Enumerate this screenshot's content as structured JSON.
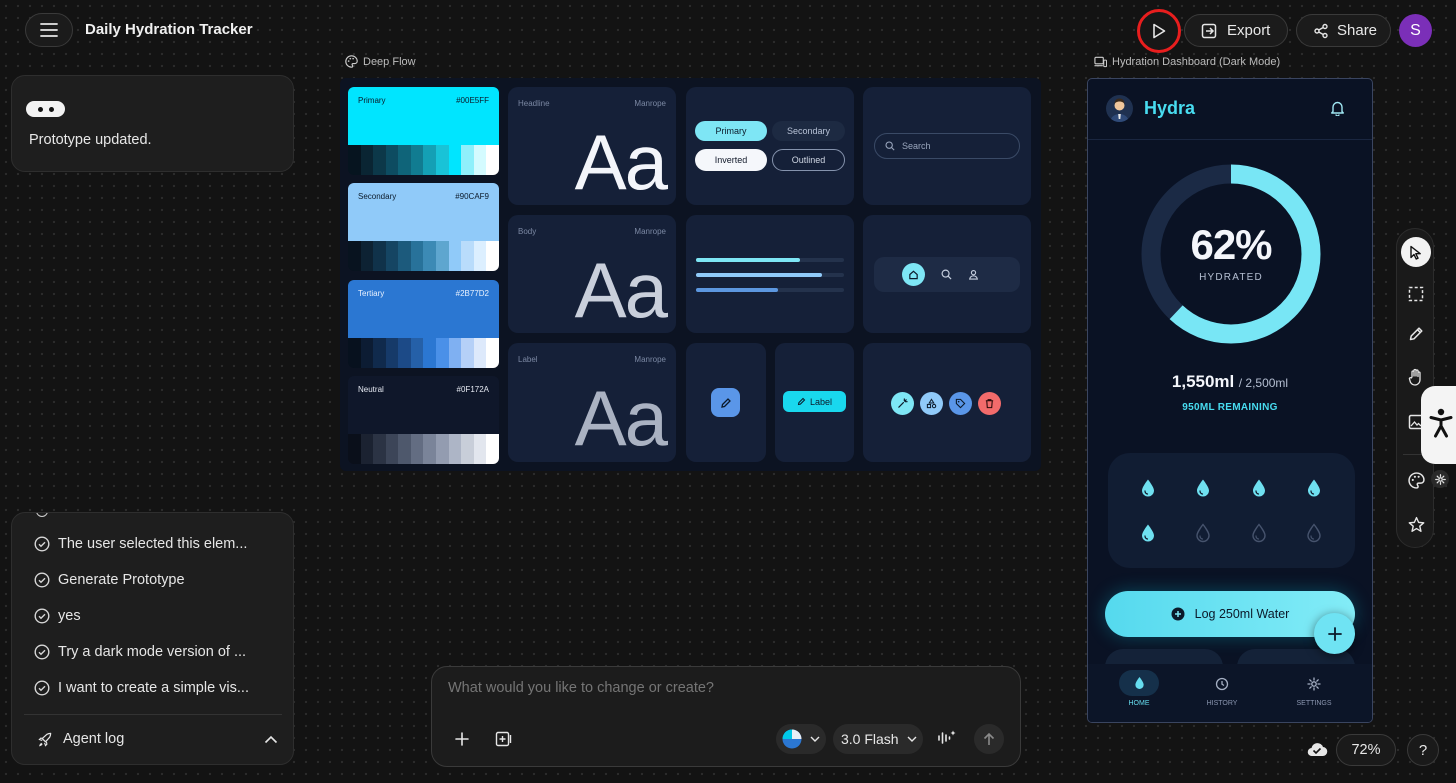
{
  "header": {
    "title": "Daily Hydration Tracker",
    "export_label": "Export",
    "share_label": "Share",
    "avatar_letter": "S"
  },
  "notice": {
    "text": "Prototype updated."
  },
  "design_system": {
    "name": "Deep Flow",
    "swatches": [
      {
        "name": "Primary",
        "hex": "#00E5FF",
        "color": "#00E5FF",
        "text": "#0b1a2a",
        "shades": [
          "#06141f",
          "#0a2533",
          "#0c3849",
          "#0d4c61",
          "#0f6479",
          "#117c91",
          "#14a0b5",
          "#19c3d7",
          "#00e5ff",
          "#8ff0fb",
          "#d4fbff",
          "#ffffff"
        ]
      },
      {
        "name": "Secondary",
        "hex": "#90CAF9",
        "color": "#90CAF9",
        "text": "#0b1a2a",
        "shades": [
          "#08131f",
          "#0d2233",
          "#10324a",
          "#154563",
          "#1c5a7c",
          "#28729a",
          "#3c8ab5",
          "#5ea6cf",
          "#90caf9",
          "#b9dcfb",
          "#dcefff",
          "#ffffff"
        ]
      },
      {
        "name": "Tertiary",
        "hex": "#2B77D2",
        "color": "#2B77D2",
        "text": "#eaf2ff",
        "shades": [
          "#07111e",
          "#0c1c33",
          "#102a4c",
          "#163a69",
          "#1c4a87",
          "#2560a8",
          "#2b77d2",
          "#4a90e8",
          "#7fb0f2",
          "#b5d0f7",
          "#dde9fb",
          "#ffffff"
        ]
      },
      {
        "name": "Neutral",
        "hex": "#0F172A",
        "color": "#0F172A",
        "text": "#e5e9f2",
        "shades": [
          "#0a0f1a",
          "#1b2231",
          "#2b3344",
          "#3c4558",
          "#4e586c",
          "#636d82",
          "#7a8499",
          "#939cb0",
          "#adb5c6",
          "#c8ced9",
          "#e2e6ee",
          "#ffffff"
        ]
      }
    ],
    "type_samples": [
      {
        "role": "Headline",
        "font": "Manrope",
        "sample": "Aa"
      },
      {
        "role": "Body",
        "font": "Manrope",
        "sample": "Aa"
      },
      {
        "role": "Label",
        "font": "Manrope",
        "sample": "Aa"
      }
    ],
    "chips": {
      "primary": "Primary",
      "secondary": "Secondary",
      "inverted": "Inverted",
      "outlined": "Outlined"
    },
    "search_placeholder": "Search",
    "label_chip": "Label"
  },
  "preview": {
    "frame_title": "Hydration Dashboard (Dark Mode)",
    "app_name": "Hydra",
    "progress_percent": 62,
    "percent_text": "62%",
    "hydrated_label": "HYDRATED",
    "consumed": "1,550ml",
    "goal": "/ 2,500ml",
    "remaining": "950ML REMAINING",
    "drops_filled": 5,
    "drops_total": 8,
    "log_button": "Log 250ml Water",
    "nav": [
      {
        "label": "HOME"
      },
      {
        "label": "HISTORY"
      },
      {
        "label": "SETTINGS"
      }
    ]
  },
  "agent_log": {
    "items": [
      "The user selected this elem...",
      "Generate Prototype",
      "yes",
      "Try a dark mode version of ...",
      "I want to create a simple vis..."
    ],
    "title": "Agent log"
  },
  "prompt": {
    "placeholder": "What would you like to change or create?",
    "model": "3.0 Flash"
  },
  "zoom": "72%",
  "help": "?",
  "colors": {
    "accent": "#00E5FF",
    "secondary": "#90CAF9",
    "tertiary": "#2B77D2",
    "neutral": "#0F172A",
    "danger": "#f26b6b",
    "highlight_ring": "#e81e1e"
  }
}
